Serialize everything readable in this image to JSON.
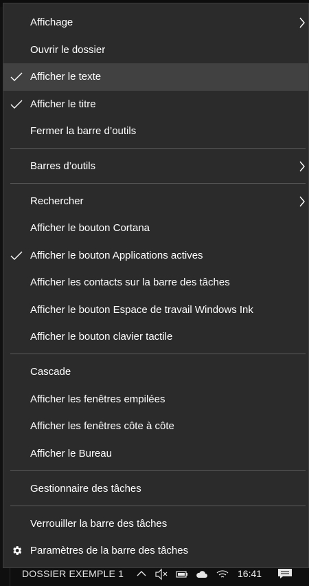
{
  "context_menu": {
    "items": [
      {
        "label": "Affichage",
        "checked": false,
        "submenu": true,
        "icon": null
      },
      {
        "label": "Ouvrir le dossier",
        "checked": false,
        "submenu": false,
        "icon": null
      },
      {
        "label": "Afficher le texte",
        "checked": true,
        "submenu": false,
        "icon": "check-icon",
        "highlighted": true
      },
      {
        "label": "Afficher le titre",
        "checked": true,
        "submenu": false,
        "icon": "check-icon"
      },
      {
        "label": "Fermer la barre d’outils",
        "checked": false,
        "submenu": false,
        "icon": null
      },
      {
        "label": "Barres d’outils",
        "checked": false,
        "submenu": true,
        "icon": null
      },
      {
        "label": "Rechercher",
        "checked": false,
        "submenu": true,
        "icon": null
      },
      {
        "label": "Afficher le bouton Cortana",
        "checked": false,
        "submenu": false,
        "icon": null
      },
      {
        "label": "Afficher le bouton Applications actives",
        "checked": true,
        "submenu": false,
        "icon": "check-icon"
      },
      {
        "label": "Afficher les contacts sur la barre des tâches",
        "checked": false,
        "submenu": false,
        "icon": null
      },
      {
        "label": "Afficher le bouton Espace de travail Windows Ink",
        "checked": false,
        "submenu": false,
        "icon": null
      },
      {
        "label": "Afficher le bouton clavier tactile",
        "checked": false,
        "submenu": false,
        "icon": null
      },
      {
        "label": "Cascade",
        "checked": false,
        "submenu": false,
        "icon": null
      },
      {
        "label": "Afficher les fenêtres empilées",
        "checked": false,
        "submenu": false,
        "icon": null
      },
      {
        "label": "Afficher les fenêtres côte à côte",
        "checked": false,
        "submenu": false,
        "icon": null
      },
      {
        "label": "Afficher le Bureau",
        "checked": false,
        "submenu": false,
        "icon": null
      },
      {
        "label": "Gestionnaire des tâches",
        "checked": false,
        "submenu": false,
        "icon": null
      },
      {
        "label": "Verrouiller la barre des tâches",
        "checked": false,
        "submenu": false,
        "icon": null
      },
      {
        "label": "Paramètres de la barre des tâches",
        "checked": false,
        "submenu": false,
        "icon": "gear-icon"
      }
    ]
  },
  "taskbar": {
    "app_label": "DOSSIER EXEMPLE 1",
    "clock": "16:41",
    "tray_icons": [
      "chevron-up-icon",
      "volume-muted-icon",
      "battery-icon",
      "cloud-icon",
      "wifi-icon"
    ],
    "notification_icon": "action-center-icon"
  },
  "colors": {
    "menu_background": "#2b2b2b",
    "highlight": "#414141",
    "separator": "#5a5a5a",
    "text": "#ffffff"
  }
}
